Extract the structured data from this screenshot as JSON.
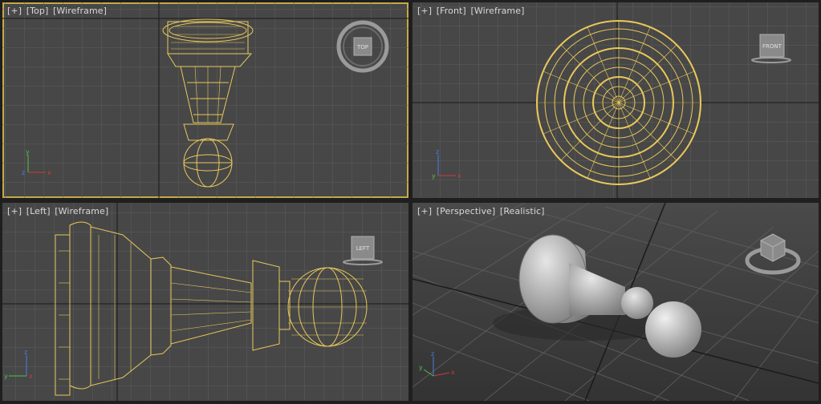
{
  "viewports": [
    {
      "id": "top",
      "labels": [
        "[+]",
        "[Top]",
        "[Wireframe]"
      ],
      "cube": "TOP",
      "active": true
    },
    {
      "id": "front",
      "labels": [
        "[+]",
        "[Front]",
        "[Wireframe]"
      ],
      "cube": "FRONT",
      "active": false
    },
    {
      "id": "left",
      "labels": [
        "[+]",
        "[Left]",
        "[Wireframe]"
      ],
      "cube": "LEFT",
      "active": false
    },
    {
      "id": "perspective",
      "labels": [
        "[+]",
        "[Perspective]",
        "[Realistic]"
      ],
      "cube": "",
      "active": false
    }
  ],
  "axes": {
    "x": "x",
    "y": "y",
    "z": "z"
  },
  "colors": {
    "wire": "#e8c85a",
    "grid": "#5a5a5a",
    "gridDark": "#1a1a1a",
    "active_border": "#c6a84a",
    "bg": "#474747"
  }
}
